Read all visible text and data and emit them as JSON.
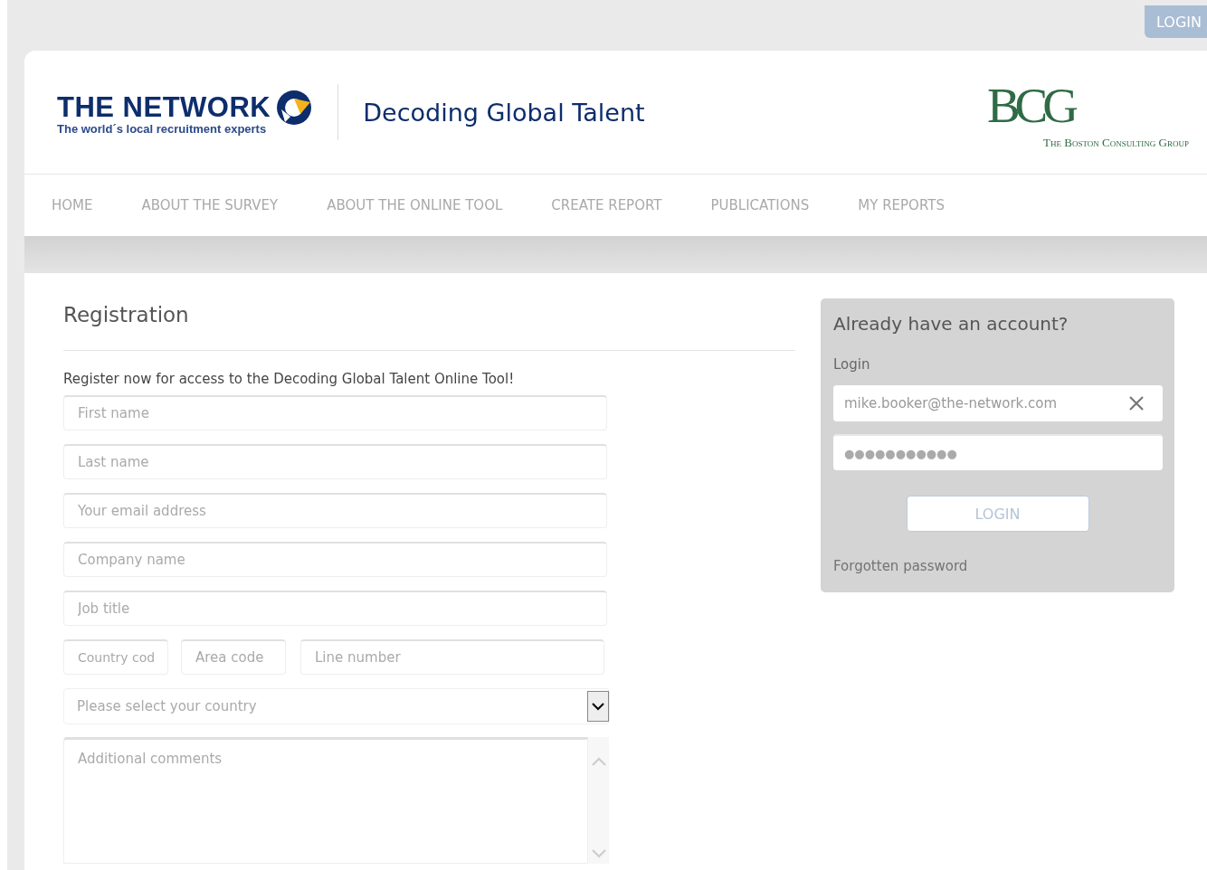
{
  "top_bar": {
    "login_button": "LOGIN"
  },
  "header": {
    "network_logo": {
      "name": "THE NETWORK",
      "tagline": "The world´s local recruitment experts"
    },
    "site_title": "Decoding Global Talent",
    "bcg_logo": {
      "mark": "BCG",
      "name": "The Boston Consulting Group"
    }
  },
  "nav": [
    {
      "label": "HOME",
      "selected": false
    },
    {
      "label": "ABOUT THE SURVEY",
      "selected": false
    },
    {
      "label": "ABOUT THE ONLINE TOOL",
      "selected": false
    },
    {
      "label": "CREATE REPORT",
      "selected": false
    },
    {
      "label": "PUBLICATIONS",
      "selected": false
    },
    {
      "label": "MY REPORTS",
      "selected": false
    }
  ],
  "registration": {
    "title": "Registration",
    "intro": "Register now for access to the Decoding Global Talent Online Tool!",
    "fields": [
      {
        "kind": "text",
        "placeholder": "First name"
      },
      {
        "kind": "text",
        "placeholder": "Last name"
      },
      {
        "kind": "text",
        "placeholder": "Your email address"
      },
      {
        "kind": "text",
        "placeholder": "Company name"
      },
      {
        "kind": "text",
        "placeholder": "Job title"
      },
      {
        "kind": "phone",
        "parts": [
          {
            "placeholder": "Country cod"
          },
          {
            "placeholder": "Area code"
          },
          {
            "placeholder": "Line number"
          }
        ]
      },
      {
        "kind": "select",
        "placeholder": "Please select your country"
      },
      {
        "kind": "textarea",
        "placeholder": "Additional comments"
      }
    ]
  },
  "login_panel": {
    "title": "Already have an account?",
    "label": "Login",
    "email": "mike.booker@the-network.com",
    "password": "●●●●●●●●●●●",
    "button": "LOGIN",
    "forgot_link": "Forgotten password"
  }
}
